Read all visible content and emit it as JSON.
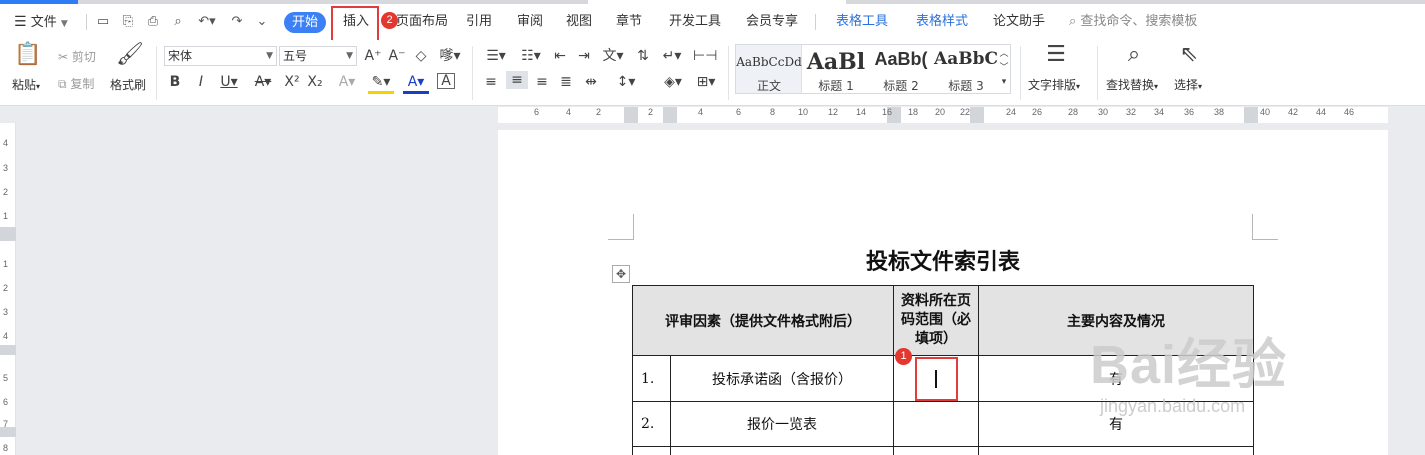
{
  "menu": {
    "file": "文件",
    "start": "开始",
    "insert": "插入",
    "tabs": [
      "页面布局",
      "引用",
      "审阅",
      "视图",
      "章节",
      "开发工具",
      "会员专享"
    ],
    "context_tabs": [
      "表格工具",
      "表格样式"
    ],
    "thesis": "论文助手",
    "search_placeholder": "查找命令、搜索模板"
  },
  "ribbon": {
    "paste": "粘贴",
    "cut": "剪切",
    "copy": "复制",
    "format_painter": "格式刷",
    "font_name": "宋体",
    "font_size": "五号",
    "styles": [
      {
        "preview": "AaBbCcDd",
        "label": "正文"
      },
      {
        "preview": "AaBl",
        "label": "标题 1"
      },
      {
        "preview": "AaBb(",
        "label": "标题 2"
      },
      {
        "preview": "AaBbC",
        "label": "标题 3"
      }
    ],
    "text_layout": "文字排版",
    "find_replace": "查找替换",
    "select": "选择"
  },
  "ruler": {
    "h_ticks": [
      "6",
      "4",
      "2",
      "2",
      "4",
      "6",
      "8",
      "10",
      "12",
      "14",
      "16",
      "18",
      "20",
      "22",
      "24",
      "26",
      "28",
      "30",
      "32",
      "34",
      "36",
      "38",
      "40",
      "42",
      "44",
      "46"
    ],
    "v_ticks": [
      "4",
      "3",
      "2",
      "1",
      "1",
      "2",
      "3",
      "4",
      "5",
      "6",
      "7",
      "8"
    ]
  },
  "document": {
    "title": "投标文件索引表",
    "table": {
      "headers": [
        "评审因素（提供文件格式附后）",
        "资料所在页码范围（必填项）",
        "主要内容及情况"
      ],
      "rows": [
        {
          "no": "1.",
          "item": "投标承诺函（含报价）",
          "pages": "",
          "content": "有"
        },
        {
          "no": "2.",
          "item": "报价一览表",
          "pages": "",
          "content": "有"
        }
      ]
    }
  },
  "annotations": {
    "badge1": "1",
    "badge2": "2"
  },
  "watermark": {
    "brand": "Bai经验",
    "url": "jingyan.baidu.com"
  },
  "colors": {
    "accent": "#3b80f4",
    "highlight_box": "#e23b3b",
    "context_tab": "#2a73d9"
  }
}
